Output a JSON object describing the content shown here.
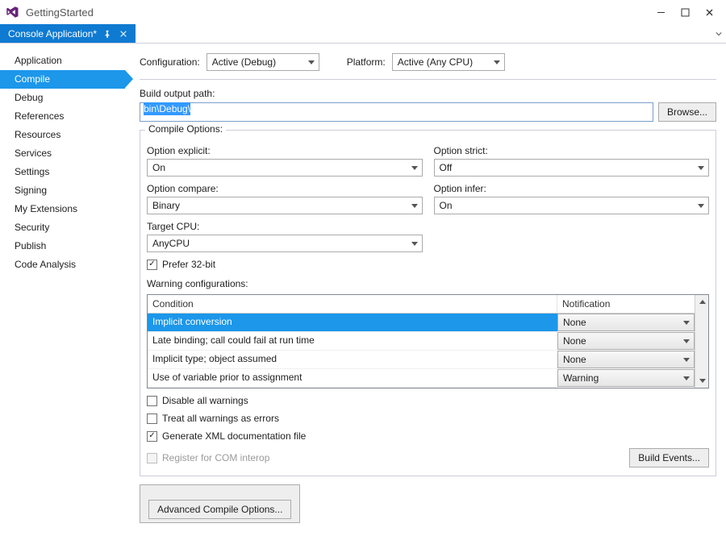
{
  "window": {
    "title": "GettingStarted"
  },
  "tab": {
    "label": "Console Application*"
  },
  "leftnav": {
    "items": [
      {
        "label": "Application"
      },
      {
        "label": "Compile",
        "selected": true
      },
      {
        "label": "Debug"
      },
      {
        "label": "References"
      },
      {
        "label": "Resources"
      },
      {
        "label": "Services"
      },
      {
        "label": "Settings"
      },
      {
        "label": "Signing"
      },
      {
        "label": "My Extensions"
      },
      {
        "label": "Security"
      },
      {
        "label": "Publish"
      },
      {
        "label": "Code Analysis"
      }
    ]
  },
  "config": {
    "configuration_label": "Configuration:",
    "configuration_value": "Active (Debug)",
    "platform_label": "Platform:",
    "platform_value": "Active (Any CPU)"
  },
  "output_path": {
    "label": "Build output path:",
    "value": "bin\\Debug\\",
    "browse_label": "Browse..."
  },
  "compile_options": {
    "legend": "Compile Options:",
    "option_explicit_label": "Option explicit:",
    "option_explicit_value": "On",
    "option_strict_label": "Option strict:",
    "option_strict_value": "Off",
    "option_compare_label": "Option compare:",
    "option_compare_value": "Binary",
    "option_infer_label": "Option infer:",
    "option_infer_value": "On",
    "target_cpu_label": "Target CPU:",
    "target_cpu_value": "AnyCPU",
    "prefer32_label": "Prefer 32-bit",
    "warning_config_label": "Warning configurations:",
    "warn_columns": {
      "condition": "Condition",
      "notification": "Notification"
    },
    "warn_rows": [
      {
        "condition": "Implicit conversion",
        "notification": "None",
        "selected": true
      },
      {
        "condition": "Late binding; call could fail at run time",
        "notification": "None"
      },
      {
        "condition": "Implicit type; object assumed",
        "notification": "None"
      },
      {
        "condition": "Use of variable prior to assignment",
        "notification": "Warning"
      }
    ],
    "disable_all_label": "Disable all warnings",
    "treat_errors_label": "Treat all warnings as errors",
    "gen_xml_label": "Generate XML documentation file",
    "register_com_label": "Register for COM interop",
    "build_events_label": "Build Events...",
    "advanced_label": "Advanced Compile Options..."
  }
}
